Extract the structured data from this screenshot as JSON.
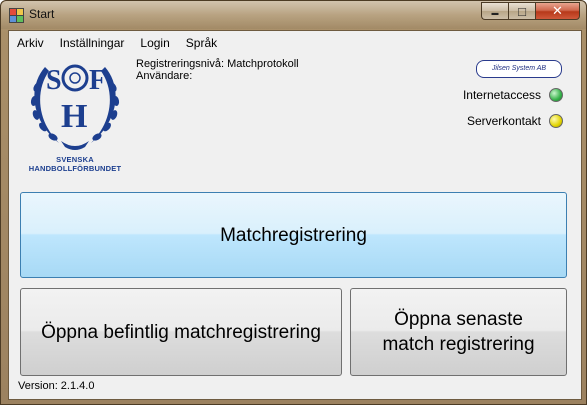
{
  "window": {
    "title": "Start",
    "close_glyph": "✕",
    "minimize_glyph": "▬",
    "maximize_glyph": "□"
  },
  "menu": [
    {
      "label": "Arkiv"
    },
    {
      "label": "Inställningar"
    },
    {
      "label": "Login"
    },
    {
      "label": "Språk"
    }
  ],
  "logo": {
    "letters": "SOFH",
    "line1": "SVENSKA",
    "line2": "HANDBOLLFÖRBUNDET"
  },
  "info": {
    "registration_level": "Registreringsnivå: Matchprotokoll",
    "user": "Användare:"
  },
  "brand": {
    "text": "Jilsen System AB"
  },
  "status": [
    {
      "label": "Internetaccess",
      "color": "#36b24a"
    },
    {
      "label": "Serverkontakt",
      "color": "#e2d400"
    }
  ],
  "buttons": {
    "match_registration": "Matchregistrering",
    "open_existing": "Öppna befintlig matchregistrering",
    "open_latest": "Öppna senaste match registrering"
  },
  "footer": {
    "version": "Version: 2.1.4.0"
  }
}
